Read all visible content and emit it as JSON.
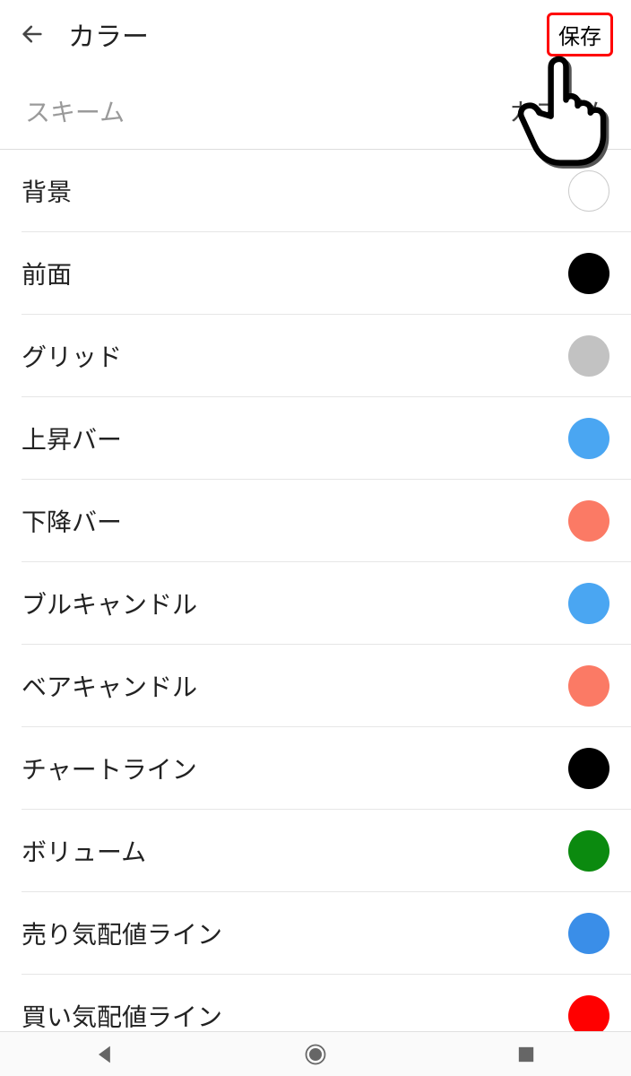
{
  "header": {
    "title": "カラー",
    "save_label": "保存"
  },
  "scheme": {
    "label": "スキーム",
    "value": "カスタム"
  },
  "items": [
    {
      "label": "背景",
      "color": "#ffffff",
      "outline": true
    },
    {
      "label": "前面",
      "color": "#000000"
    },
    {
      "label": "グリッド",
      "color": "#c2c2c2"
    },
    {
      "label": "上昇バー",
      "color": "#4aa6f2"
    },
    {
      "label": "下降バー",
      "color": "#fb7a65"
    },
    {
      "label": "ブルキャンドル",
      "color": "#4aa6f2"
    },
    {
      "label": "ベアキャンドル",
      "color": "#fb7a65"
    },
    {
      "label": "チャートライン",
      "color": "#000000"
    },
    {
      "label": "ボリューム",
      "color": "#0b8a0f"
    },
    {
      "label": "売り気配値ライン",
      "color": "#3a8ee8"
    },
    {
      "label": "買い気配値ライン",
      "color": "#ff0000"
    }
  ]
}
